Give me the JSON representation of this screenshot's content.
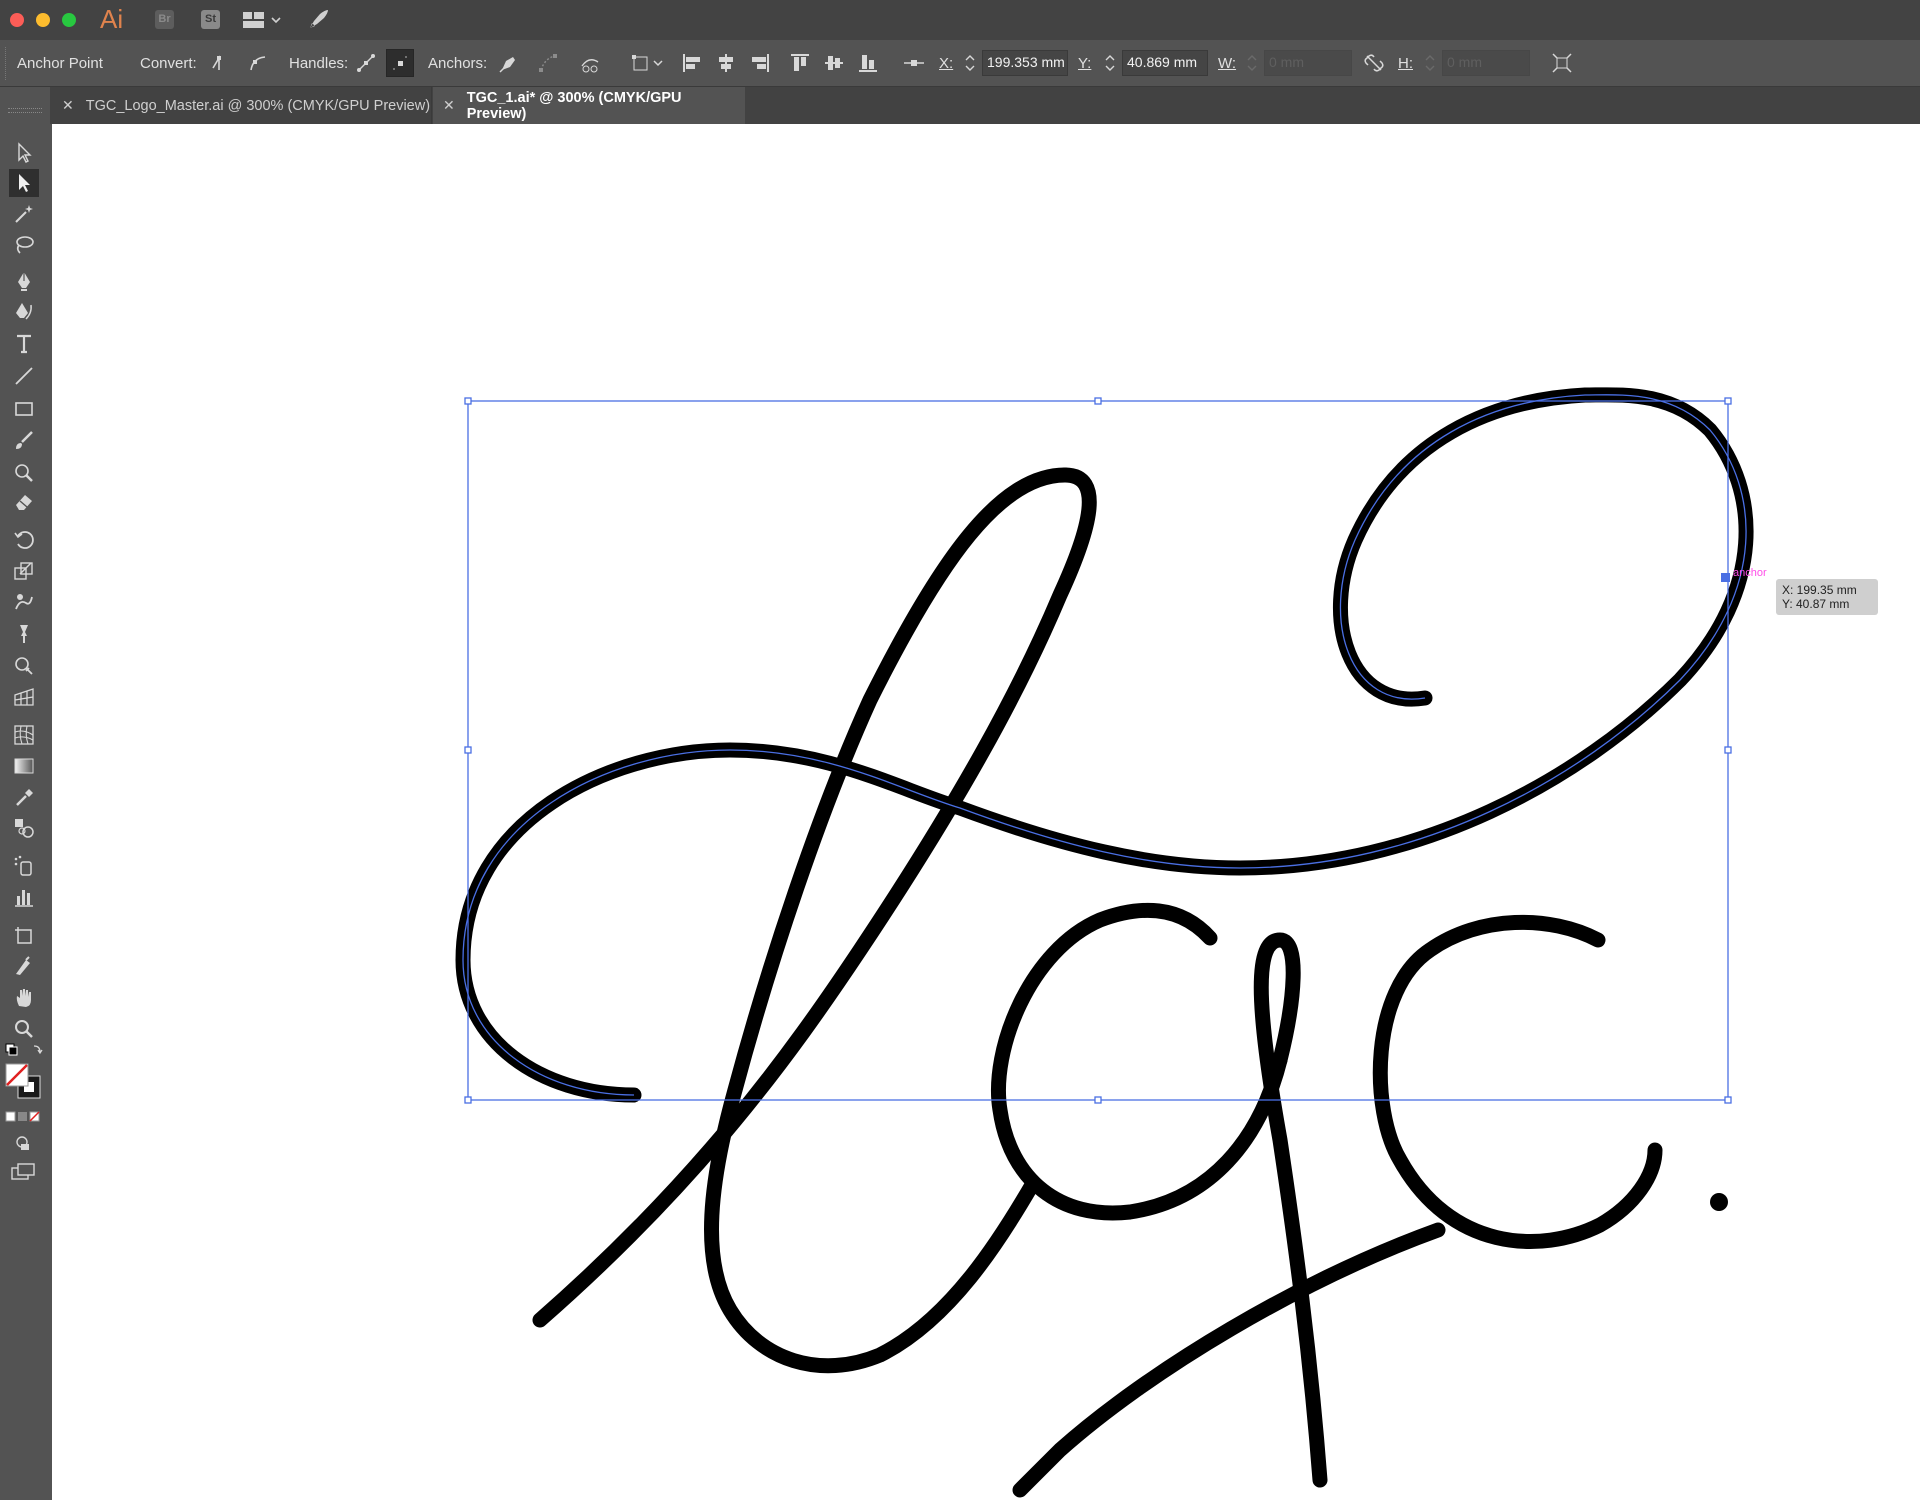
{
  "app": {
    "logo": "Ai",
    "bridge_label": "Br",
    "stock_label": "St",
    "traffic_colors": {
      "close": "#fc5d57",
      "minimize": "#fdbc2e",
      "zoom": "#28c840"
    }
  },
  "controlbar": {
    "selection_type": "Anchor Point",
    "convert_label": "Convert:",
    "handles_label": "Handles:",
    "anchors_label": "Anchors:",
    "x_label": "X:",
    "x_value": "199.353 mm",
    "y_label": "Y:",
    "y_value": "40.869 mm",
    "w_label": "W:",
    "w_value": "0 mm",
    "h_label": "H:",
    "h_value": "0 mm"
  },
  "tabs": [
    {
      "title": "TGC_Logo_Master.ai @ 300% (CMYK/GPU Preview)",
      "active": false
    },
    {
      "title": "TGC_1.ai* @ 300% (CMYK/GPU Preview)",
      "active": true
    }
  ],
  "tools": [
    "selection-tool",
    "direct-selection-tool",
    "magic-wand-tool",
    "lasso-tool",
    "pen-tool",
    "curvature-tool",
    "type-tool",
    "line-segment-tool",
    "rectangle-tool",
    "paintbrush-tool",
    "shaper-tool",
    "eraser-tool",
    "rotate-tool",
    "scale-tool",
    "warp-tool",
    "puppet-warp-tool",
    "shape-builder-tool",
    "perspective-grid-tool",
    "mesh-tool",
    "gradient-tool",
    "eyedropper-tool",
    "blend-tool",
    "symbol-sprayer-tool",
    "column-graph-tool",
    "artboard-tool",
    "slice-tool",
    "hand-tool",
    "zoom-tool"
  ],
  "canvas": {
    "smart_guide_label": "anchor",
    "readout_x": "X: 199.35 mm",
    "readout_y": "Y: 40.87 mm",
    "stroke_color": "#000000",
    "selection_color": "#4a6fe3"
  }
}
